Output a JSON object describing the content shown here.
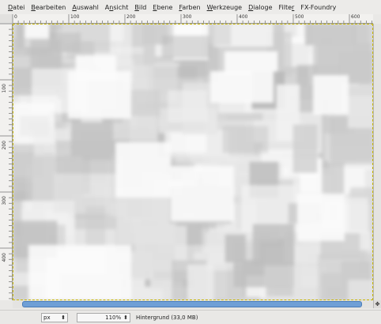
{
  "menubar": {
    "items": [
      {
        "label": "Datei",
        "u": "D"
      },
      {
        "label": "Bearbeiten",
        "u": "B"
      },
      {
        "label": "Auswahl",
        "u": "A"
      },
      {
        "label": "Ansicht",
        "u": "n"
      },
      {
        "label": "Bild",
        "u": "B"
      },
      {
        "label": "Ebene",
        "u": "E"
      },
      {
        "label": "Farben",
        "u": "F"
      },
      {
        "label": "Werkzeuge",
        "u": "W"
      },
      {
        "label": "Dialoge",
        "u": "D"
      },
      {
        "label": "Filter",
        "u": "r"
      },
      {
        "label": "FX-Foundry",
        "u": ""
      }
    ]
  },
  "ruler_top": {
    "labels": [
      "0",
      "100",
      "200",
      "300",
      "400",
      "500",
      "600"
    ]
  },
  "ruler_left": {
    "labels": [
      "100",
      "200",
      "300",
      "400"
    ]
  },
  "canvas": {
    "border_color": "#c8b600",
    "background": "#dcdcdc"
  },
  "statusbar": {
    "unit": "px",
    "zoom": "110%",
    "layer_info": "Hintergrund (33,0 MB)"
  },
  "colors": {
    "scroll_thumb": "#6f9fd6"
  }
}
